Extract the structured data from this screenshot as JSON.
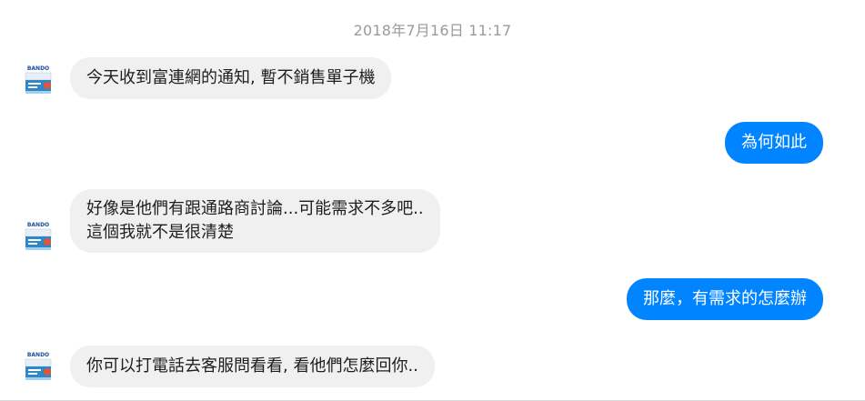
{
  "conversation": {
    "timestamp": "2018年7月16日 11:17",
    "contact": {
      "avatar_brand": "BANDO",
      "avatar_icon": "product-box-logo"
    },
    "messages": [
      {
        "direction": "incoming",
        "lines": [
          "今天收到富連網的通知, 暫不銷售單子機"
        ]
      },
      {
        "direction": "outgoing",
        "lines": [
          "為何如此"
        ]
      },
      {
        "direction": "incoming",
        "lines": [
          "好像是他們有跟通路商討論...可能需求不多吧..",
          "這個我就不是很清楚"
        ]
      },
      {
        "direction": "outgoing",
        "lines": [
          "那麼，有需求的怎麼辦"
        ]
      },
      {
        "direction": "incoming",
        "lines": [
          "你可以打電話去客服問看看, 看他們怎麼回你.."
        ]
      }
    ]
  },
  "colors": {
    "incoming_bubble": "#f1f0f0",
    "outgoing_bubble": "#0084ff",
    "timestamp_text": "#9a9a9a"
  }
}
